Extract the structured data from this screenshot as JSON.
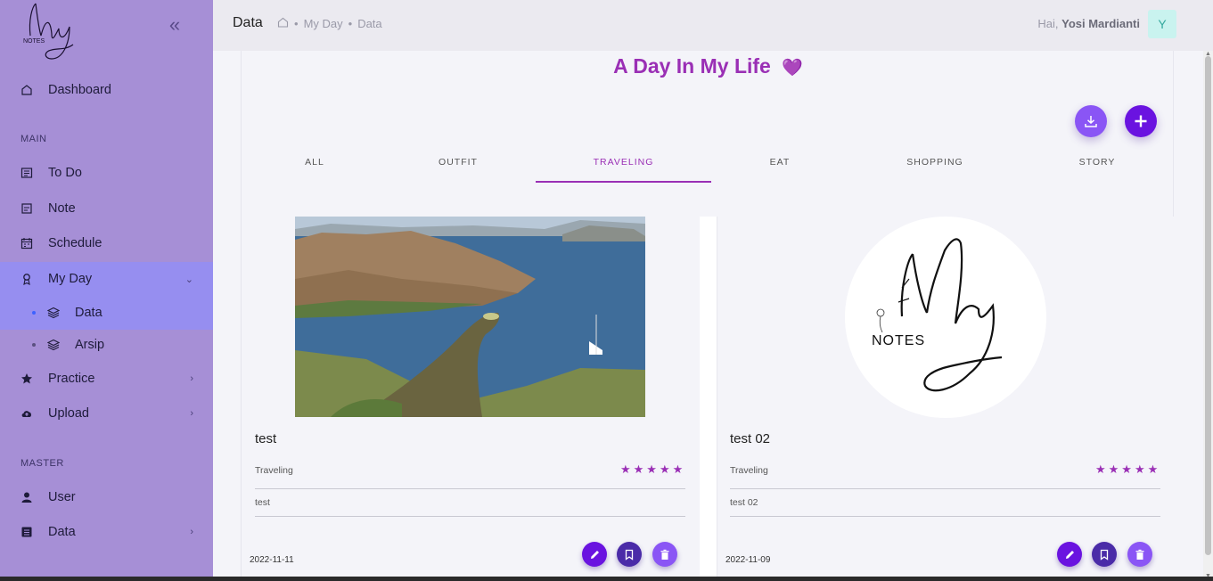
{
  "sidebar": {
    "logo_text": "NOTES",
    "dashboard": "Dashboard",
    "section_main": "MAIN",
    "section_master": "MASTER",
    "items": {
      "todo": "To Do",
      "note": "Note",
      "schedule": "Schedule",
      "myday": "My Day",
      "data": "Data",
      "arsip": "Arsip",
      "practice": "Practice",
      "upload": "Upload",
      "user": "User",
      "master_data": "Data"
    }
  },
  "header": {
    "title": "Data",
    "breadcrumb": [
      "My Day",
      "Data"
    ],
    "greeting": "Hai,",
    "user_name": "Yosi Mardianti",
    "avatar_letter": "Y"
  },
  "main": {
    "heading": "A Day In My Life",
    "heading_emoji": "💜",
    "tabs": [
      "ALL",
      "OUTFIT",
      "TRAVELING",
      "EAT",
      "SHOPPING",
      "STORY"
    ],
    "active_tab": "TRAVELING",
    "cards": [
      {
        "title": "test",
        "category": "Traveling",
        "rating": "★★★★★",
        "description": "test",
        "date": "2022-11-11"
      },
      {
        "title": "test 02",
        "category": "Traveling",
        "rating": "★★★★★",
        "description": "test 02",
        "date": "2022-11-09",
        "logo_text": "NOTES"
      }
    ]
  },
  "colors": {
    "sidebar": "#a68fd6",
    "accent": "#9a2fb5",
    "primary": "#6a13e0"
  }
}
